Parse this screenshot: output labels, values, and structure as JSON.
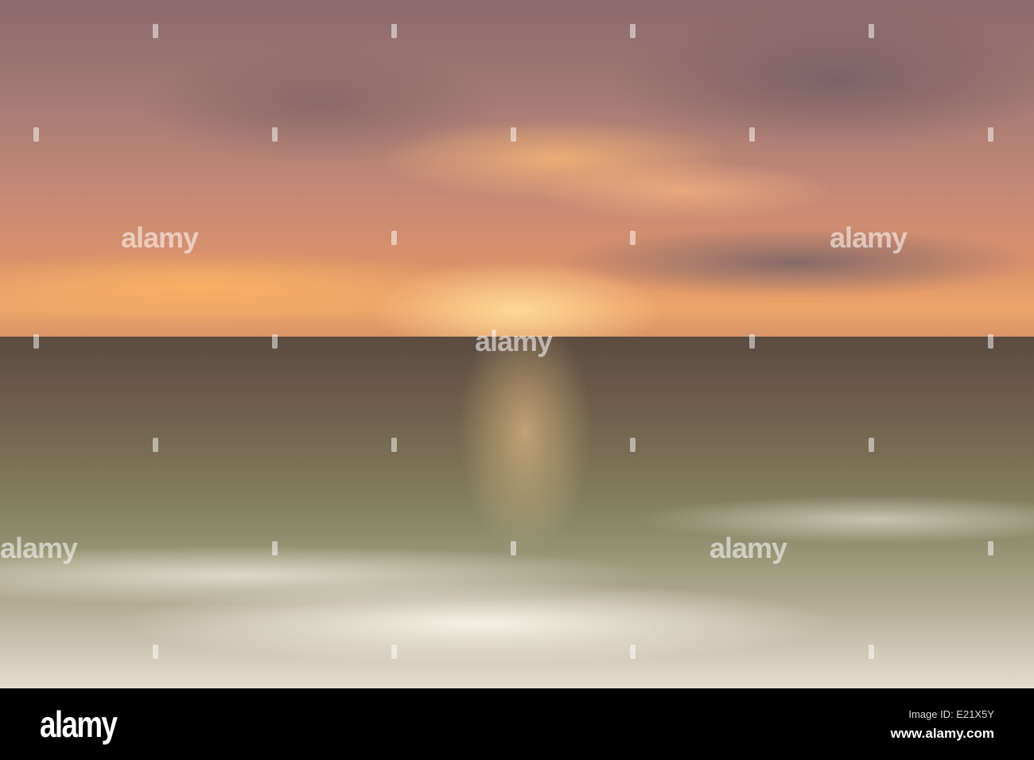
{
  "watermark": {
    "text": "alamy"
  },
  "footer": {
    "logo": "alamy",
    "image_id": "Image ID: E21X5Y",
    "website": "www.alamy.com"
  }
}
